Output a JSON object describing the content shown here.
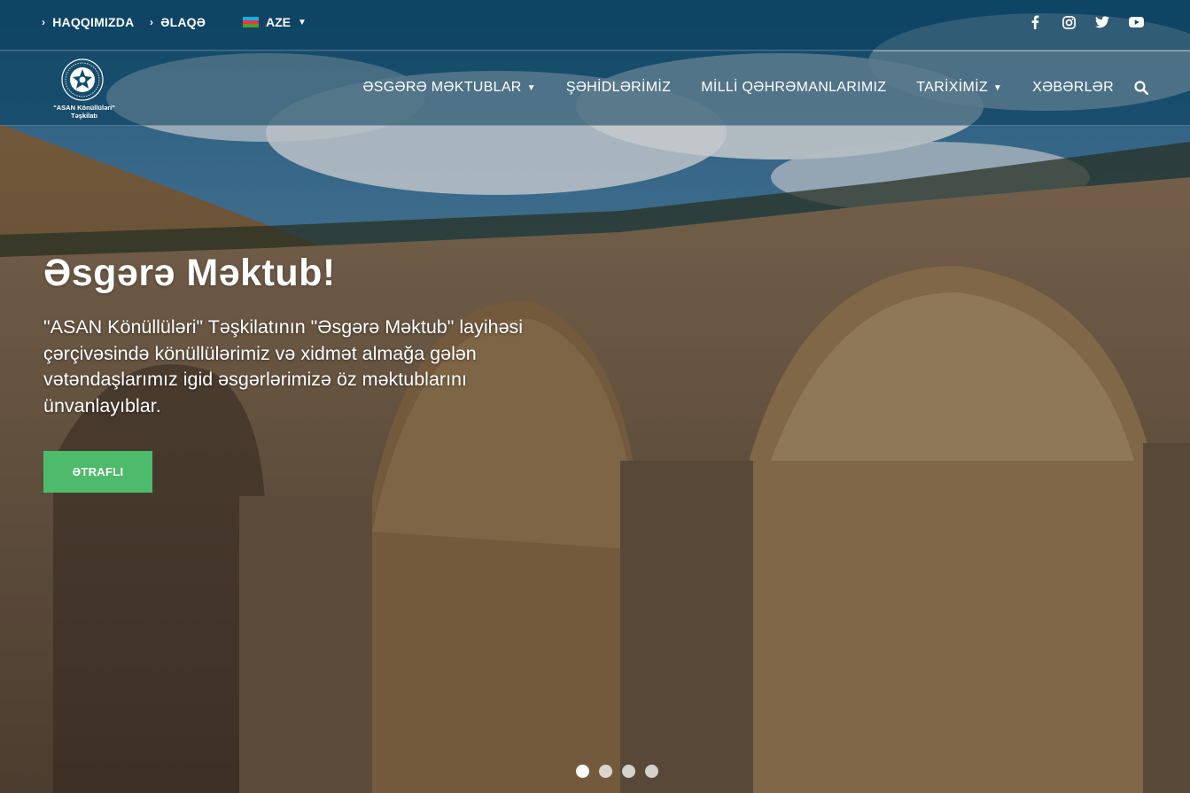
{
  "topbar": {
    "links": [
      {
        "label": "HAQQIMIZDA"
      },
      {
        "label": "ƏLAQƏ"
      }
    ],
    "language": {
      "label": "AZE",
      "flag_colors": [
        "#00b5e2",
        "#ef3340",
        "#509e2f"
      ]
    },
    "social": [
      {
        "icon": "facebook-icon"
      },
      {
        "icon": "instagram-icon"
      },
      {
        "icon": "twitter-icon"
      },
      {
        "icon": "youtube-icon"
      }
    ]
  },
  "logo": {
    "line1": "\"ASAN Könüllüləri\"",
    "line2": "Təşkilatı"
  },
  "nav": {
    "items": [
      {
        "label": "ƏSGƏRƏ MƏKTUBLAR",
        "dropdown": true
      },
      {
        "label": "ŞƏHİDLƏRİMİZ",
        "dropdown": false
      },
      {
        "label": "MİLLİ QƏHRƏMANLARIMIZ",
        "dropdown": false
      },
      {
        "label": "TARİXİMİZ",
        "dropdown": true
      },
      {
        "label": "XƏBƏRLƏR",
        "dropdown": false
      }
    ],
    "search_icon": "search-icon"
  },
  "slide": {
    "title": "Əsgərə Məktub!",
    "text": "\"ASAN Könüllüləri\" Təşkilatının \"Əsgərə Məktub\" layihəsi çərçivəsində könüllülərimiz və xidmət almağa gələn vətəndaşlarımız igid əsgərlərimizə öz məktublarını ünvanlayıblar.",
    "button": "ƏTRAFLI"
  },
  "pagination": {
    "count": 4,
    "active": 1
  },
  "colors": {
    "accent_green": "#4dbb6b",
    "header_blue": "#063c5a"
  }
}
